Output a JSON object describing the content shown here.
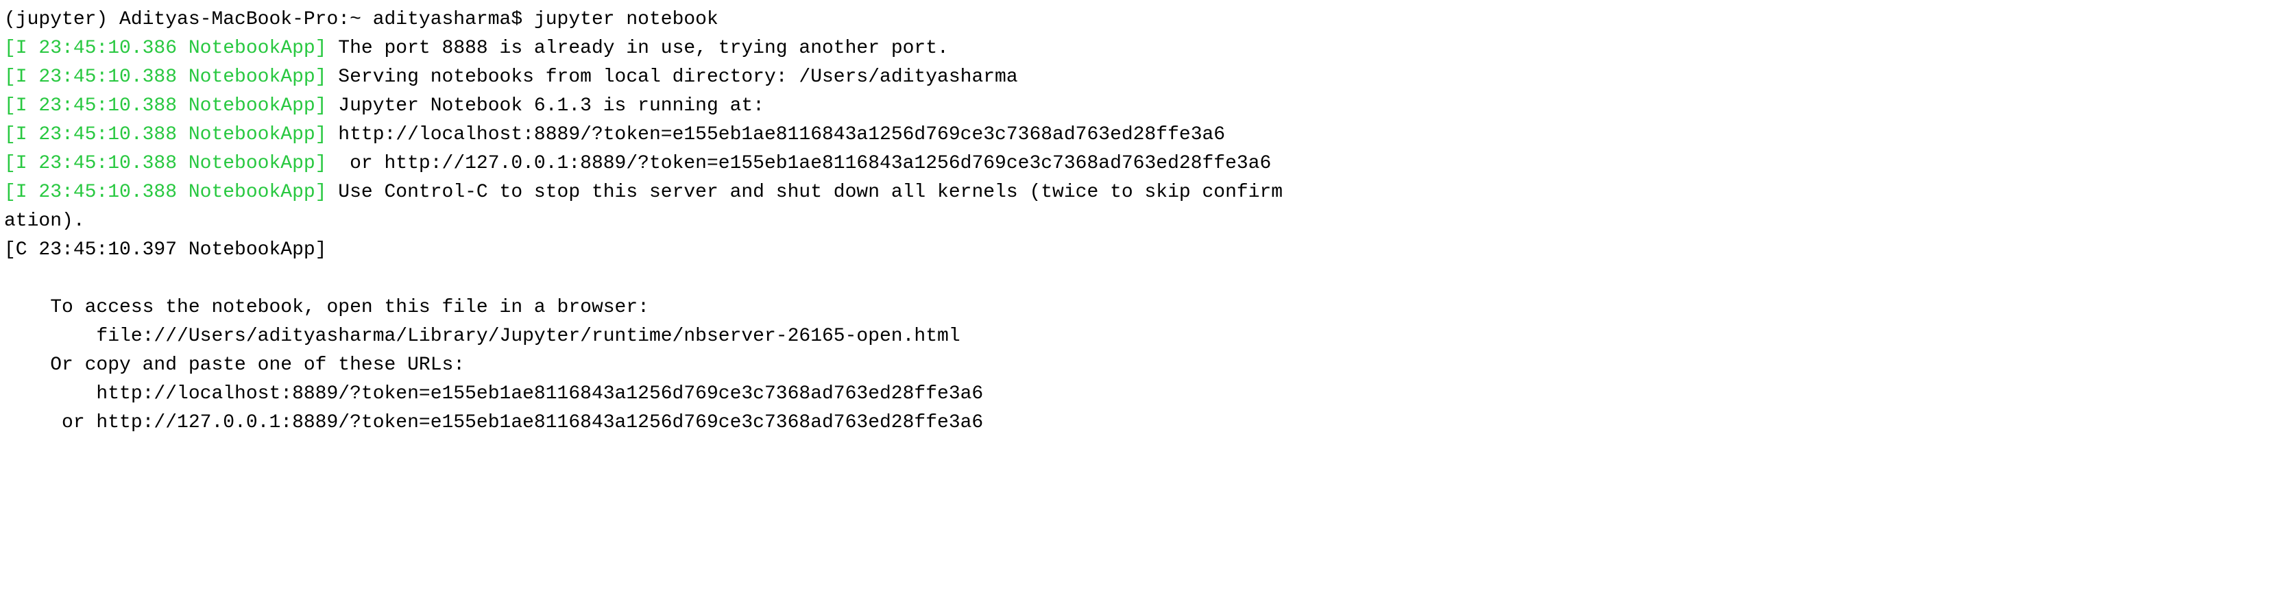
{
  "prompt": "(jupyter) Adityas-MacBook-Pro:~ adityasharma$ ",
  "command": "jupyter notebook",
  "logs": [
    {
      "prefix": "[I 23:45:10.386 NotebookApp]",
      "msg": " The port 8888 is already in use, trying another port."
    },
    {
      "prefix": "[I 23:45:10.388 NotebookApp]",
      "msg": " Serving notebooks from local directory: /Users/adityasharma"
    },
    {
      "prefix": "[I 23:45:10.388 NotebookApp]",
      "msg": " Jupyter Notebook 6.1.3 is running at:"
    },
    {
      "prefix": "[I 23:45:10.388 NotebookApp]",
      "msg": " http://localhost:8889/?token=e155eb1ae8116843a1256d769ce3c7368ad763ed28ffe3a6"
    },
    {
      "prefix": "[I 23:45:10.388 NotebookApp]",
      "msg": "  or http://127.0.0.1:8889/?token=e155eb1ae8116843a1256d769ce3c7368ad763ed28ffe3a6"
    },
    {
      "prefix": "[I 23:45:10.388 NotebookApp]",
      "msg": " Use Control-C to stop this server and shut down all kernels (twice to skip confirm"
    }
  ],
  "wrap_tail": "ation).",
  "c_prefix": "[C 23:45:10.397 NotebookApp]",
  "c_msg": " ",
  "blank": "",
  "body": [
    "    To access the notebook, open this file in a browser:",
    "        file:///Users/adityasharma/Library/Jupyter/runtime/nbserver-26165-open.html",
    "    Or copy and paste one of these URLs:",
    "        http://localhost:8889/?token=e155eb1ae8116843a1256d769ce3c7368ad763ed28ffe3a6",
    "     or http://127.0.0.1:8889/?token=e155eb1ae8116843a1256d769ce3c7368ad763ed28ffe3a6"
  ]
}
